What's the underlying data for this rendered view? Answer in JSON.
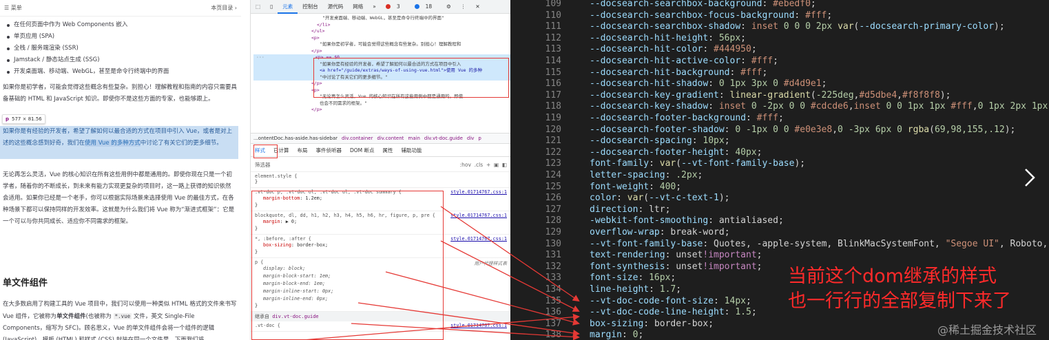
{
  "doc": {
    "menu_label": "菜单",
    "toc_label": "本页目录",
    "list_items": [
      "在任何页面中作为 Web Components 嵌入",
      "单页应用 (SPA)",
      "全栈 / 服务端渲染 (SSR)",
      "Jamstack / 静态站点生成 (SSG)",
      "开发桌面端、移动端、WebGL，甚至是命令行终端中的界面"
    ],
    "para1": "如果你是初学者，可能会觉得这些概念有些复杂。别担心！理解教程和指南的内容只需要具备基础的 HTML 和 JavaScript 知识。即使你不是这些方面的专家，也能够跟上。",
    "tooltip_tag": "p",
    "tooltip_size": "577 × 81.56",
    "para2_a": "如果你是有经验的开发者，希望了解如何以最合适的方式在项目中引入 Vue，或者是对上述的这些概念感到好奇，我们在",
    "para2_link": "使用 Vue 的多种方式",
    "para2_b": "中讨论了有关它们的更多细节。",
    "para3": "无论再怎么灵活，Vue 的核心知识在所有这些用例中都是通用的。即使你现在只是一个初学者，随着你的不断成长，到未来有能力实现更复杂的项目时，这一路上获得的知识依然会适用。如果你已经是一个老手，你可以根据实际场景来选择使用 Vue 的最佳方式，在各种场景下都可以保持同样的开发效率。这就是为什么我们将 Vue 称为“渐进式框架”：它是一个可以与你共同成长、适应你不同需求的框架。",
    "heading": "单文件组件",
    "para4_a": "在大多数启用了构建工具的 Vue 项目中，我们可以使用一种类似 HTML 格式的文件来书写 Vue 组件，它被称为",
    "para4_bold": "单文件组件",
    "para4_b": "(也被称为",
    "para4_code": "*.vue",
    "para4_c": "文件，英文 Single-File Components，缩写为 SFC)。顾名思义，Vue 的单文件组件会将一个组件的逻辑 (JavaScript)，模板 (HTML) 和样式 (CSS) 封装在同一个文件里。下面我们将"
  },
  "devtools": {
    "tabs": [
      "元素",
      "控制台",
      "源代码",
      "网络"
    ],
    "errors": "3",
    "warnings": "18",
    "dom_lines": [
      "\"开发桌面端、移动端、WebGL，甚至是命令行终端中的界面\"",
      "</li>",
      "</ul>",
      "<p>",
      "\"如果你是初学者，可能会觉得这些概念有些复杂。别担心！理解教程和",
      "</p>",
      "<p> == $0",
      "\"如果你是有经验的开发者，希望了解如何以最合适的方式在项目中引入",
      "<a href=\"/guide/extras/ways-of-using-vue.html\">使用 Vue 的多种",
      "\"中讨论了有关它们的更多细节。\"",
      "</p>",
      "<p>",
      "\"无论再怎么灵活，Vue 的核心知识在所有这些用例中都是通用的。即使",
      "也会不同需求的框架。\"",
      "</p>"
    ],
    "breadcrumb": [
      "...ontentDoc.has-aside.has-sidebar",
      "div.container",
      "div.content",
      "main",
      "div.vt-doc.guide",
      "div",
      "p"
    ],
    "subtabs": [
      "样式",
      "已计算",
      "布局",
      "事件侦听器",
      "DOM 断点",
      "属性",
      "辅助功能"
    ],
    "filter_placeholder": "筛选器",
    "filter_tools": [
      ":hov",
      ".cls",
      "+"
    ],
    "rules": [
      {
        "selector": "element.style {",
        "decls": [],
        "source": ""
      },
      {
        "selector": ".vt-doc p, .vt-doc ol, .vt-doc ul, .vt-doc summary {",
        "decls": [
          [
            "margin-bottom",
            "1.2em;"
          ]
        ],
        "source": "style.01714767.css:1"
      },
      {
        "selector": "blockquote, dl, dd, h1, h2, h3, h4, h5, h6, hr, figure, p, pre {",
        "decls": [
          [
            "margin",
            "▶ 0;"
          ]
        ],
        "source": "style.01714767.css:1"
      },
      {
        "selector": "*, :before, :after {",
        "decls": [
          [
            "box-sizing",
            "border-box;"
          ]
        ],
        "source": "style.01714767.css:1"
      },
      {
        "selector": "p {",
        "decls": [
          [
            "display",
            "block;"
          ],
          [
            "margin-block-start",
            "1em;"
          ],
          [
            "margin-block-end",
            "1em;"
          ],
          [
            "margin-inline-start",
            "0px;"
          ],
          [
            "margin-inline-end",
            "0px;"
          ]
        ],
        "source": "用户代理样式表"
      }
    ],
    "inherited_label": "继承自",
    "inherited_from": "div.vt-doc.guide",
    "last_rule_selector": ".vt-doc {",
    "last_rule_source": "style.01714767.css:1"
  },
  "code": {
    "lines": [
      {
        "n": "109",
        "t": [
          [
            "p",
            "--docsearch-searchbox-background"
          ],
          [
            "w",
            ": "
          ],
          [
            "v",
            "#ebedf0"
          ],
          [
            "w",
            ";"
          ]
        ]
      },
      {
        "n": "110",
        "t": [
          [
            "p",
            "--docsearch-searchbox-focus-background"
          ],
          [
            "w",
            ": "
          ],
          [
            "v",
            "#fff"
          ],
          [
            "w",
            ";"
          ]
        ]
      },
      {
        "n": "111",
        "t": [
          [
            "p",
            "--docsearch-searchbox-shadow"
          ],
          [
            "w",
            ": "
          ],
          [
            "v",
            "inset "
          ],
          [
            "n",
            "0 0 0 2px "
          ],
          [
            "f",
            "var"
          ],
          [
            "w",
            "("
          ],
          [
            "p",
            "--docsearch-primary-color"
          ],
          [
            "w",
            ");"
          ]
        ]
      },
      {
        "n": "112",
        "t": [
          [
            "p",
            "--docsearch-hit-height"
          ],
          [
            "w",
            ": "
          ],
          [
            "n",
            "56px"
          ],
          [
            "w",
            ";"
          ]
        ]
      },
      {
        "n": "113",
        "t": [
          [
            "p",
            "--docsearch-hit-color"
          ],
          [
            "w",
            ": "
          ],
          [
            "v",
            "#444950"
          ],
          [
            "w",
            ";"
          ]
        ]
      },
      {
        "n": "114",
        "t": [
          [
            "p",
            "--docsearch-hit-active-color"
          ],
          [
            "w",
            ": "
          ],
          [
            "v",
            "#fff"
          ],
          [
            "w",
            ";"
          ]
        ]
      },
      {
        "n": "115",
        "t": [
          [
            "p",
            "--docsearch-hit-background"
          ],
          [
            "w",
            ": "
          ],
          [
            "v",
            "#fff"
          ],
          [
            "w",
            ";"
          ]
        ]
      },
      {
        "n": "116",
        "t": [
          [
            "p",
            "--docsearch-hit-shadow"
          ],
          [
            "w",
            ": "
          ],
          [
            "n",
            "0 1px 3px 0 "
          ],
          [
            "v",
            "#d4d9e1"
          ],
          [
            "w",
            ";"
          ]
        ]
      },
      {
        "n": "117",
        "t": [
          [
            "p",
            "--docsearch-key-gradient"
          ],
          [
            "w",
            ": "
          ],
          [
            "f",
            "linear-gradient"
          ],
          [
            "w",
            "("
          ],
          [
            "n",
            "-225deg"
          ],
          [
            "w",
            ","
          ],
          [
            "v",
            "#d5dbe4"
          ],
          [
            "w",
            ","
          ],
          [
            "v",
            "#f8f8f8"
          ],
          [
            "w",
            ");"
          ]
        ]
      },
      {
        "n": "118",
        "t": [
          [
            "p",
            "--docsearch-key-shadow"
          ],
          [
            "w",
            ": "
          ],
          [
            "v",
            "inset "
          ],
          [
            "n",
            "0 -2px 0 0 "
          ],
          [
            "v",
            "#cdcde6"
          ],
          [
            "w",
            ","
          ],
          [
            "v",
            "inset "
          ],
          [
            "n",
            "0 0 1px 1px "
          ],
          [
            "v",
            "#fff"
          ],
          [
            "w",
            ","
          ],
          [
            "n",
            "0 1px 2px 1px"
          ]
        ]
      },
      {
        "n": "119",
        "t": [
          [
            "p",
            "--docsearch-footer-background"
          ],
          [
            "w",
            ": "
          ],
          [
            "v",
            "#fff"
          ],
          [
            "w",
            ";"
          ]
        ]
      },
      {
        "n": "120",
        "t": [
          [
            "p",
            "--docsearch-footer-shadow"
          ],
          [
            "w",
            ": "
          ],
          [
            "n",
            "0 -1px 0 0 "
          ],
          [
            "v",
            "#e0e3e8"
          ],
          [
            "w",
            ","
          ],
          [
            "n",
            "0 -3px 6px 0 "
          ],
          [
            "f",
            "rgba"
          ],
          [
            "w",
            "("
          ],
          [
            "n",
            "69,98,155,.12"
          ],
          [
            "w",
            ");"
          ]
        ]
      },
      {
        "n": "121",
        "t": [
          [
            "p",
            "--docsearch-spacing"
          ],
          [
            "w",
            ": "
          ],
          [
            "n",
            "10px"
          ],
          [
            "w",
            ";"
          ]
        ]
      },
      {
        "n": "122",
        "t": [
          [
            "p",
            "--docsearch-footer-height"
          ],
          [
            "w",
            ": "
          ],
          [
            "n",
            "40px"
          ],
          [
            "w",
            ";"
          ]
        ]
      },
      {
        "n": "123",
        "t": [
          [
            "p",
            "font-family"
          ],
          [
            "w",
            ": "
          ],
          [
            "f",
            "var"
          ],
          [
            "w",
            "("
          ],
          [
            "p",
            "--vt-font-family-base"
          ],
          [
            "w",
            ");"
          ]
        ]
      },
      {
        "n": "124",
        "t": [
          [
            "p",
            "letter-spacing"
          ],
          [
            "w",
            ": "
          ],
          [
            "n",
            ".2px"
          ],
          [
            "w",
            ";"
          ]
        ]
      },
      {
        "n": "125",
        "t": [
          [
            "p",
            "font-weight"
          ],
          [
            "w",
            ": "
          ],
          [
            "n",
            "400"
          ],
          [
            "w",
            ";"
          ]
        ]
      },
      {
        "n": "126",
        "t": [
          [
            "p",
            "color"
          ],
          [
            "w",
            ": "
          ],
          [
            "f",
            "var"
          ],
          [
            "w",
            "("
          ],
          [
            "p",
            "--vt-c-text-1"
          ],
          [
            "w",
            ");"
          ]
        ]
      },
      {
        "n": "127",
        "t": [
          [
            "p",
            "direction"
          ],
          [
            "w",
            ": "
          ],
          [
            "w",
            "ltr"
          ],
          [
            "w",
            ";"
          ]
        ]
      },
      {
        "n": "128",
        "t": [
          [
            "p",
            "-webkit-font-smoothing"
          ],
          [
            "w",
            ": "
          ],
          [
            "w",
            "antialiased"
          ],
          [
            "w",
            ";"
          ]
        ]
      },
      {
        "n": "129",
        "t": [
          [
            "p",
            "overflow-wrap"
          ],
          [
            "w",
            ": "
          ],
          [
            "w",
            "break-word"
          ],
          [
            "w",
            ";"
          ]
        ]
      },
      {
        "n": "130",
        "t": [
          [
            "p",
            "--vt-font-family-base"
          ],
          [
            "w",
            ": "
          ],
          [
            "w",
            "Quotes, -apple-system, BlinkMacSystemFont, "
          ],
          [
            "v",
            "\"Segoe UI\""
          ],
          [
            "w",
            ", Roboto,"
          ]
        ]
      },
      {
        "n": "131",
        "t": [
          [
            "p",
            "text-rendering"
          ],
          [
            "w",
            ": "
          ],
          [
            "w",
            "unset"
          ],
          [
            "kw",
            "!important"
          ],
          [
            "w",
            ";"
          ]
        ]
      },
      {
        "n": "132",
        "t": [
          [
            "p",
            "font-synthesis"
          ],
          [
            "w",
            ": "
          ],
          [
            "w",
            "unset"
          ],
          [
            "kw",
            "!important"
          ],
          [
            "w",
            ";"
          ]
        ]
      },
      {
        "n": "133",
        "t": [
          [
            "p",
            "font-size"
          ],
          [
            "w",
            ": "
          ],
          [
            "n",
            "16px"
          ],
          [
            "w",
            ";"
          ]
        ]
      },
      {
        "n": "134",
        "t": [
          [
            "p",
            "line-height"
          ],
          [
            "w",
            ": "
          ],
          [
            "n",
            "1.7"
          ],
          [
            "w",
            ";"
          ]
        ]
      },
      {
        "n": "135",
        "t": [
          [
            "p",
            "--vt-doc-code-font-size"
          ],
          [
            "w",
            ": "
          ],
          [
            "n",
            "14px"
          ],
          [
            "w",
            ";"
          ]
        ]
      },
      {
        "n": "136",
        "t": [
          [
            "p",
            "--vt-doc-code-line-height"
          ],
          [
            "w",
            ": "
          ],
          [
            "n",
            "1.5"
          ],
          [
            "w",
            ";"
          ]
        ]
      },
      {
        "n": "137",
        "t": [
          [
            "p",
            "box-sizing"
          ],
          [
            "w",
            ": "
          ],
          [
            "w",
            "border-box"
          ],
          [
            "w",
            ";"
          ]
        ]
      },
      {
        "n": "138",
        "t": [
          [
            "p",
            "margin"
          ],
          [
            "w",
            ": "
          ],
          [
            "n",
            "0"
          ],
          [
            "w",
            ";"
          ]
        ]
      }
    ],
    "annotation_line1": "当前这个dom继承的样式",
    "annotation_line2": "也一行行的全部复制下来了",
    "watermark": "@稀土掘金技术社区"
  }
}
